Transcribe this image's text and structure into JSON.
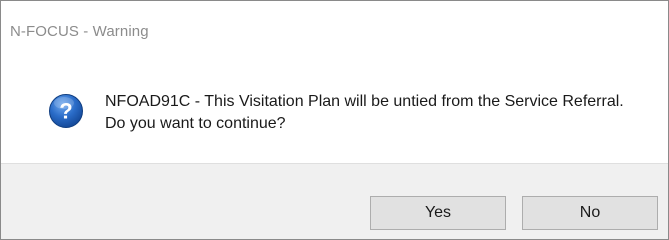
{
  "window": {
    "title": "N-FOCUS - Warning"
  },
  "dialog": {
    "icon": "question-icon",
    "message": "NFOAD91C - This Visitation Plan will be untied from the Service Referral. Do you want to continue?"
  },
  "buttons": {
    "yes_label": "Yes",
    "no_label": "No"
  },
  "colors": {
    "icon_blue": "#1f5fb8",
    "footer_bg": "#f0f0f0",
    "button_bg": "#e1e1e1"
  }
}
